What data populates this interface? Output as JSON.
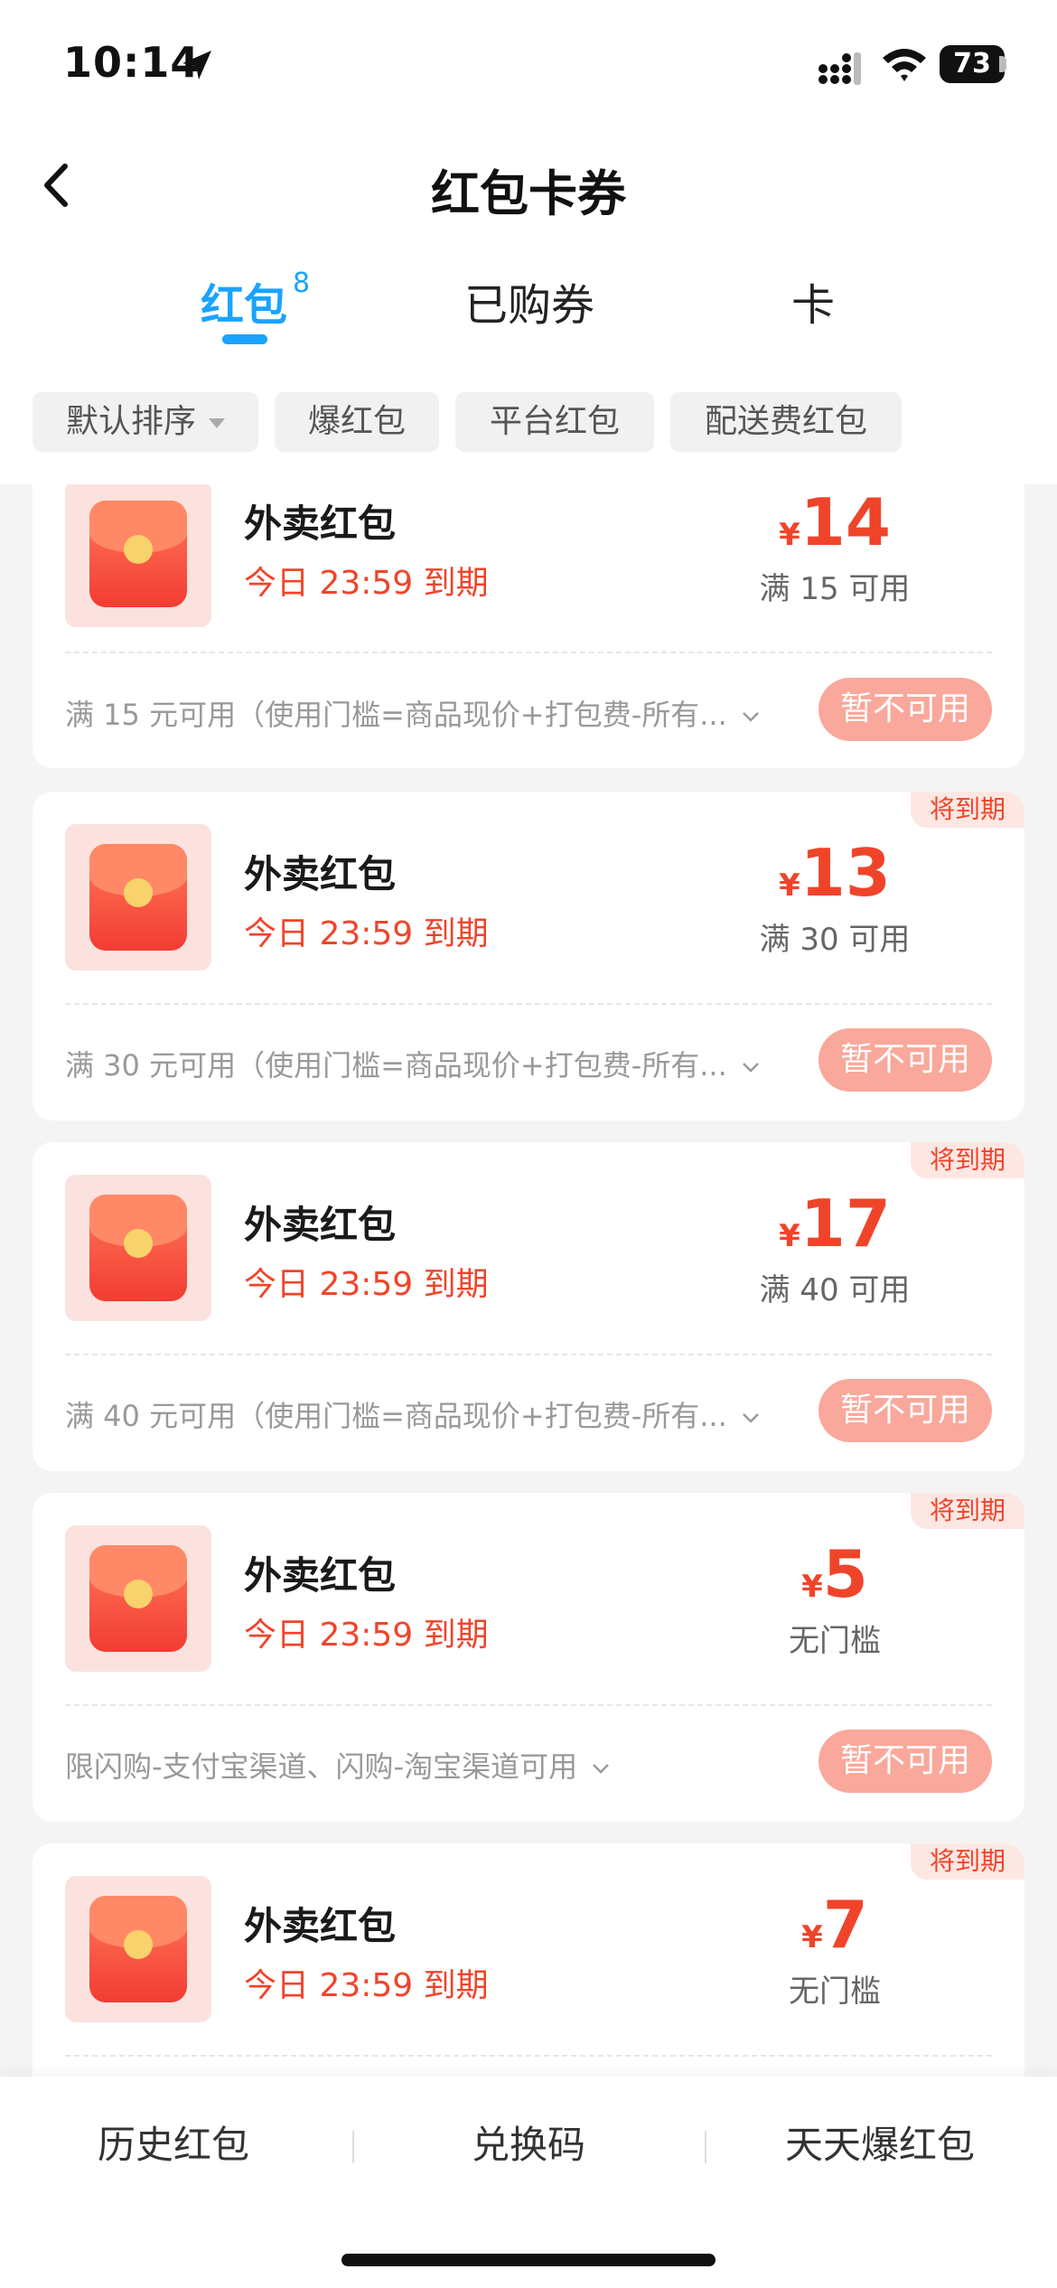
{
  "status_bar": {
    "time": "10:14",
    "battery": "73"
  },
  "header": {
    "title": "红包卡券"
  },
  "tabs": [
    {
      "label": "红包",
      "badge": "8",
      "active": true
    },
    {
      "label": "已购券"
    },
    {
      "label": "卡"
    }
  ],
  "filters": [
    {
      "label": "默认排序"
    },
    {
      "label": "爆红包"
    },
    {
      "label": "平台红包"
    },
    {
      "label": "配送费红包"
    }
  ],
  "cards": [
    {
      "name": "外卖红包",
      "expiry": "今日 23:59 到期",
      "currency": "¥",
      "amount": "14",
      "condition": "满 15 可用",
      "description": "满 15 元可用（使用门槛=商品现价+打包费-所有...",
      "button": "暂不可用"
    },
    {
      "badge": "将到期",
      "name": "外卖红包",
      "expiry": "今日 23:59 到期",
      "currency": "¥",
      "amount": "13",
      "condition": "满 30 可用",
      "description": "满 30 元可用（使用门槛=商品现价+打包费-所有...",
      "button": "暂不可用"
    },
    {
      "badge": "将到期",
      "name": "外卖红包",
      "expiry": "今日 23:59 到期",
      "currency": "¥",
      "amount": "17",
      "condition": "满 40 可用",
      "description": "满 40 元可用（使用门槛=商品现价+打包费-所有...",
      "button": "暂不可用"
    },
    {
      "badge": "将到期",
      "name": "外卖红包",
      "expiry": "今日 23:59 到期",
      "currency": "¥",
      "amount": "5",
      "condition": "无门槛",
      "description": "限闪购-支付宝渠道、闪购-淘宝渠道可用",
      "button": "暂不可用"
    },
    {
      "badge": "将到期",
      "name": "外卖红包",
      "expiry": "今日 23:59 到期",
      "currency": "¥",
      "amount": "7",
      "condition": "无门槛"
    }
  ],
  "bottom_bar": {
    "history": "历史红包",
    "redeem": "兑换码",
    "daily": "天天爆红包"
  },
  "colors": {
    "accent": "#1aa3ff",
    "red": "#f0442a",
    "disabled_button": "#f9a89b"
  }
}
